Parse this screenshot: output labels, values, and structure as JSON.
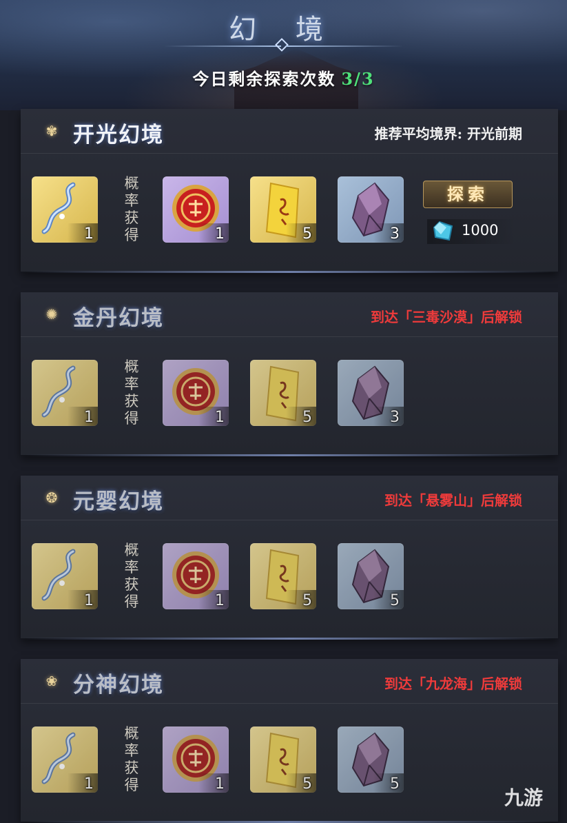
{
  "header": {
    "title": "幻 境",
    "count_label": "今日剩余探索次数",
    "count_value": "3/3"
  },
  "probability_label": [
    "概",
    "率",
    "获",
    "得"
  ],
  "sections": [
    {
      "name": "开光幻境",
      "requirement": "推荐平均境界: 开光前期",
      "locked": false,
      "items": [
        {
          "icon": "spirit-wisp-icon",
          "qty": "1"
        },
        {
          "icon": "red-medallion-icon",
          "qty": "1"
        },
        {
          "icon": "talisman-scroll-icon",
          "qty": "5"
        },
        {
          "icon": "purple-crystal-icon",
          "qty": "3"
        }
      ],
      "explore_label": "探索",
      "cost_icon": "spirit-stone-icon",
      "cost_value": "1000"
    },
    {
      "name": "金丹幻境",
      "requirement": "到达「三毒沙漠」后解锁",
      "locked": true,
      "items": [
        {
          "icon": "spirit-wisp-icon",
          "qty": "1"
        },
        {
          "icon": "red-medallion-icon",
          "qty": "1"
        },
        {
          "icon": "talisman-scroll-icon",
          "qty": "5"
        },
        {
          "icon": "purple-crystal-icon",
          "qty": "3"
        }
      ]
    },
    {
      "name": "元婴幻境",
      "requirement": "到达「悬雾山」后解锁",
      "locked": true,
      "items": [
        {
          "icon": "spirit-wisp-icon",
          "qty": "1"
        },
        {
          "icon": "red-medallion-icon",
          "qty": "1"
        },
        {
          "icon": "talisman-scroll-icon",
          "qty": "5"
        },
        {
          "icon": "purple-crystal-icon",
          "qty": "5"
        }
      ]
    },
    {
      "name": "分神幻境",
      "requirement": "到达「九龙海」后解锁",
      "locked": true,
      "items": [
        {
          "icon": "spirit-wisp-icon",
          "qty": "1"
        },
        {
          "icon": "red-medallion-icon",
          "qty": "1"
        },
        {
          "icon": "talisman-scroll-icon",
          "qty": "5"
        },
        {
          "icon": "purple-crystal-icon",
          "qty": "5"
        }
      ]
    }
  ],
  "watermark": "九游",
  "colors": {
    "count_green": "#4fe07a",
    "locked_red": "#ef3b3b",
    "gold_accent": "#b8985c"
  }
}
